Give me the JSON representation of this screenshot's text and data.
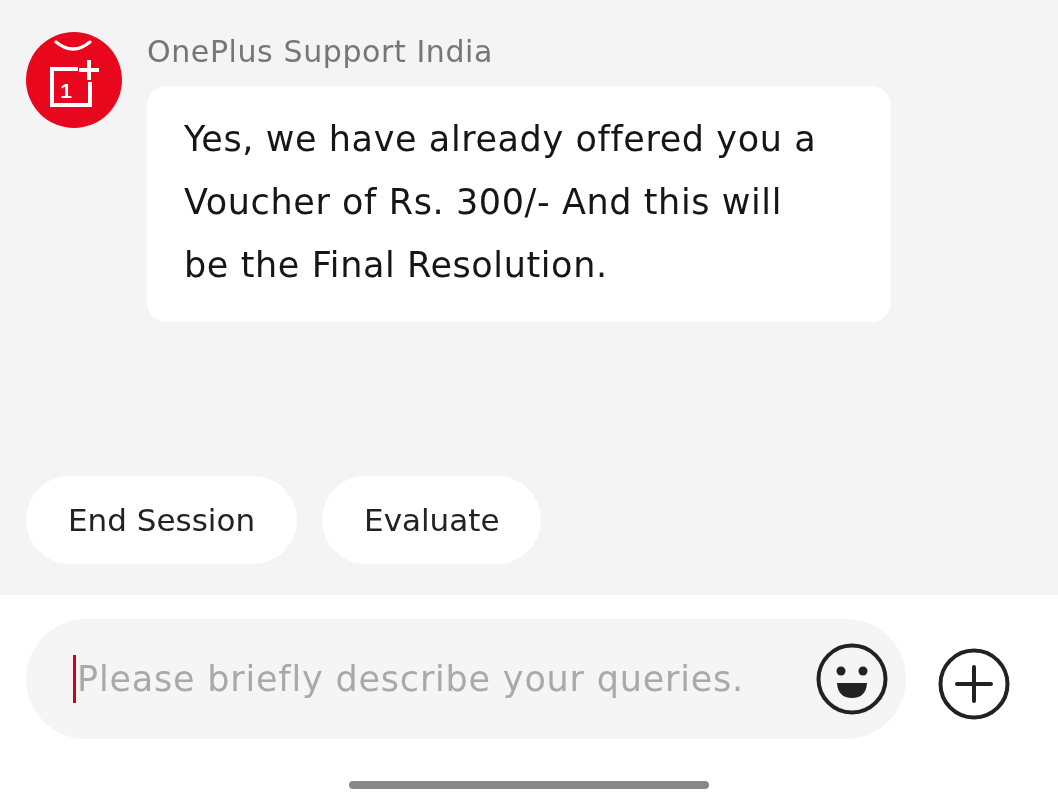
{
  "chat": {
    "sender": {
      "name": "OnePlus Support India",
      "logo_mark": "1"
    },
    "messages": [
      {
        "text": "Yes, we have already offered you a Voucher of Rs. 300/- And this will be the Final Resolution."
      }
    ]
  },
  "quick_actions": [
    {
      "label": "End Session"
    },
    {
      "label": "Evaluate"
    }
  ],
  "composer": {
    "placeholder": "Please briefly describe your queries.",
    "focused": true
  }
}
